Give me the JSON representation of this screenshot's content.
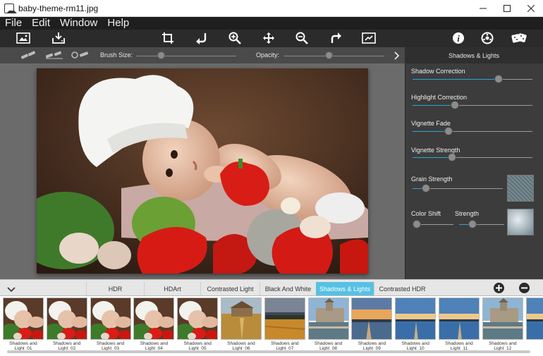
{
  "window": {
    "title": "baby-theme-rm11.jpg"
  },
  "menu": [
    "File",
    "Edit",
    "Window",
    "Help"
  ],
  "toolbar": {
    "icons": [
      "open-image-icon",
      "save-image-icon",
      "crop-icon",
      "undo-icon",
      "zoom-in-icon",
      "move-icon",
      "zoom-out-icon",
      "redo-icon",
      "fit-image-icon",
      "info-icon",
      "settings-icon",
      "random-dice-icon"
    ]
  },
  "options": {
    "brush_size_label": "Brush Size:",
    "brush_size_value": 0.25,
    "opacity_label": "Opacity:",
    "opacity_value": 0.45
  },
  "panel": {
    "title": "Shadows & Lights",
    "sliders": [
      {
        "label": "Shadow Correction",
        "value": 0.72
      },
      {
        "label": "Highlight Correction",
        "value": 0.35
      },
      {
        "label": "Vignette Fade",
        "value": 0.3
      },
      {
        "label": "Vignette Strength",
        "value": 0.33
      },
      {
        "label": "Grain Strength",
        "value": 0.15
      }
    ],
    "color_shift_label": "Color Shift",
    "color_shift_value": 0.0,
    "strength_label": "Strength",
    "strength_value": 0.3
  },
  "presets": {
    "tabs": [
      "HDR",
      "HDArt",
      "Contrasted Light",
      "Black And White",
      "Shadows & Lights",
      "Contrasted HDR"
    ],
    "active_tab": "Shadows & Lights",
    "accent_color": "#56c1e3"
  },
  "thumbnails": [
    {
      "label": "Shadows and Light_01",
      "kind": "baby"
    },
    {
      "label": "Shadows and Light_02",
      "kind": "baby"
    },
    {
      "label": "Shadows and Light_03",
      "kind": "baby"
    },
    {
      "label": "Shadows and Light_04",
      "kind": "baby"
    },
    {
      "label": "Shadows and Light_05",
      "kind": "baby"
    },
    {
      "label": "Shadows and Light_06",
      "kind": "field"
    },
    {
      "label": "Shadows and Light_07",
      "kind": "wheat"
    },
    {
      "label": "Shadows and Light_08",
      "kind": "castle"
    },
    {
      "label": "Shadows and Light_09",
      "kind": "sunset"
    },
    {
      "label": "Shadows and Light_10",
      "kind": "lake"
    },
    {
      "label": "Shadows and Light_11",
      "kind": "lake"
    },
    {
      "label": "Shadows and Light_12",
      "kind": "castle"
    },
    {
      "label": "",
      "kind": "lake"
    }
  ]
}
